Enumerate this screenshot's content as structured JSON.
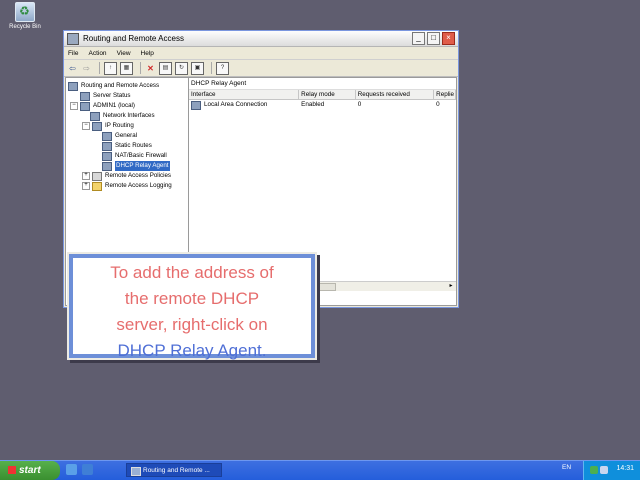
{
  "desktop": {
    "recycle_bin": "Recycle Bin"
  },
  "window": {
    "title": "Routing and Remote Access",
    "menu": [
      "File",
      "Action",
      "View",
      "Help"
    ],
    "tree": [
      "Routing and Remote Access",
      "Server Status",
      "ADMIN1 (local)",
      "Network Interfaces",
      "IP Routing",
      "General",
      "Static Routes",
      "NAT/Basic Firewall",
      "DHCP Relay Agent",
      "Remote Access Policies",
      "Remote Access Logging"
    ],
    "detail_title": "DHCP Relay Agent",
    "columns": [
      "Interface",
      "Relay mode",
      "Requests received",
      "Replie"
    ],
    "rows": [
      {
        "interface": "Local Area Connection",
        "relay_mode": "Enabled",
        "requests": "0",
        "replies": "0"
      }
    ]
  },
  "callout": {
    "line1": "To add the address of",
    "line2": "the remote DHCP",
    "line3": "server, right-click on",
    "line4": "DHCP Relay Agent."
  },
  "taskbar": {
    "start": "start",
    "task": "Routing and Remote ...",
    "lang": "EN",
    "clock": "14:31"
  },
  "colors": {
    "desktop": "#5f5d6f",
    "callout_text": "#e66d6d",
    "callout_highlight": "#4f6fd6",
    "selection": "#316ac5"
  }
}
